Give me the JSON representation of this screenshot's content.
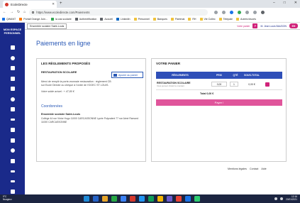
{
  "browser": {
    "tab_title": "EcoleDirecte",
    "new_tab_symbol": "+",
    "window_controls": [
      "–",
      "□",
      "✕"
    ],
    "url": "https://www.ecoledirecte.com/Paiements",
    "bookmarks": [
      "QWANT",
      "Portail Orange Juin...",
      "la cas scolaire",
      "Authentification",
      "Accueil",
      "LinkedIn",
      "Personnel",
      "Banques",
      "Partenai",
      "RH",
      "Vie Collec",
      "Telepaie",
      "Autres favoris"
    ]
  },
  "sidebar": {
    "title_line1": "MON ESPACE",
    "title_line2": "PERSONNEL",
    "icons": [
      "home-icon",
      "user-icon",
      "group-icon",
      "calendar-icon",
      "document-icon",
      "clock-icon",
      "folder-icon",
      "list-icon",
      "mail-icon",
      "chart-icon",
      "share-icon",
      "euro-icon",
      "menu-icon",
      "lines-icon",
      "table-icon",
      "cloud-icon"
    ]
  },
  "header": {
    "school": "Ensemble scolaire Saint-Louis",
    "cart_link": "Votre panier",
    "cart_badge": "P",
    "user": "M. Jean Louis BAUDON",
    "avatar": "EH"
  },
  "page": {
    "title": "Paiements en ligne"
  },
  "reglements": {
    "heading": "LES RÈGLEMENTS PROPOSÉS",
    "section": "RESTAURATION SCOLAIRE",
    "add_button": "Ajouter au panier",
    "description": "Merci de remplir la porte-monnaie restauration : règlement CB sur Ecole Directe ou chèque à l'ordre de l'OGEC ST LOUIS.",
    "solde": "Votre solde actuel : + 47,80 €",
    "coord_heading": "Coordonnées",
    "coord_name": "Ensemble scolaire Saint-Louis",
    "coord_address": "Collège 44 rue Victor Hugo 11000 CARCASSONNE Lycée Polyvalent 77 rue Aimé Ramond 11000 CARCASSONNE"
  },
  "cart": {
    "heading": "VOTRE PANIER",
    "columns": {
      "name": "RÈGLEMENTS",
      "price": "PRIX",
      "qty": "QTÉ",
      "subtotal": "SOUS-TOTAL"
    },
    "items": [
      {
        "name": "RESTAURATION SCOLAIRE",
        "note": "Vous pouvez choisir le montant",
        "price": "0,00",
        "qty": "1",
        "subtotal": "0,00 €"
      }
    ],
    "total": "Total 0,00 €",
    "pay_button": "Payer !"
  },
  "footer_links": [
    "Mentions légales",
    "Contact",
    "Aide"
  ],
  "taskbar": {
    "weather_line1": "9°C",
    "weather_line2": "Nuageux",
    "time": "12:16",
    "date": "20/01/2021",
    "app_colors": [
      "#1e8bd8",
      "#2563c7",
      "#e6a52a",
      "#27a844",
      "#3b82f6",
      "#d4382c",
      "#2196f3",
      "#0f9d58",
      "#f4b400",
      "#6a5acd",
      "#e94235",
      "#1a73e8",
      "#2ecc71"
    ]
  },
  "colors": {
    "sidebar_bg": "#1a2a8a",
    "title_blue": "#2a59b6",
    "cart_header": "#2f4fb8",
    "accent_pink": "#d0237a",
    "pay_button": "#e0559b",
    "taskbar": "#1c2541"
  }
}
